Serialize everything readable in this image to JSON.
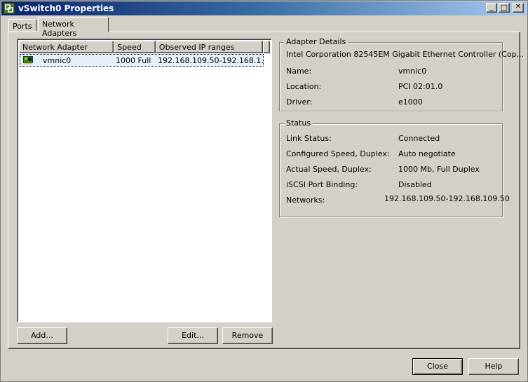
{
  "window": {
    "title": "vSwitch0 Properties",
    "controls": {
      "minimize": "_",
      "maximize": "□",
      "close": "✕"
    }
  },
  "tabs": [
    {
      "label": "Ports",
      "active": false
    },
    {
      "label": "Network Adapters",
      "active": true
    }
  ],
  "adapter_list": {
    "columns": [
      "Network Adapter",
      "Speed",
      "Observed IP ranges"
    ],
    "rows": [
      {
        "name": "vmnic0",
        "speed": "1000 Full",
        "ip_ranges": "192.168.109.50-192.168.1...",
        "icon": "network-card-icon",
        "selected": true
      }
    ]
  },
  "list_buttons": {
    "add": "Add...",
    "edit": "Edit...",
    "remove": "Remove"
  },
  "adapter_details": {
    "legend": "Adapter Details",
    "description": "Intel Corporation 82545EM Gigabit Ethernet Controller (Cop...",
    "name_label": "Name:",
    "name_value": "vmnic0",
    "location_label": "Location:",
    "location_value": "PCI 02:01.0",
    "driver_label": "Driver:",
    "driver_value": "e1000"
  },
  "status": {
    "legend": "Status",
    "link_status_label": "Link Status:",
    "link_status_value": "Connected",
    "configured_speed_label": "Configured Speed, Duplex:",
    "configured_speed_value": "Auto negotiate",
    "actual_speed_label": "Actual Speed, Duplex:",
    "actual_speed_value": "1000 Mb, Full Duplex",
    "iscsi_label": "iSCSI Port Binding:",
    "iscsi_value": "Disabled",
    "networks_label": "Networks:",
    "networks_value": "192.168.109.50-192.168.109.50"
  },
  "footer_buttons": {
    "close": "Close",
    "help": "Help"
  },
  "colors": {
    "title_gradient_start": "#0a246a",
    "title_gradient_end": "#a6caf0",
    "dialog_face": "#d4d0c8",
    "nic_icon_green": "#2e8b2e"
  }
}
